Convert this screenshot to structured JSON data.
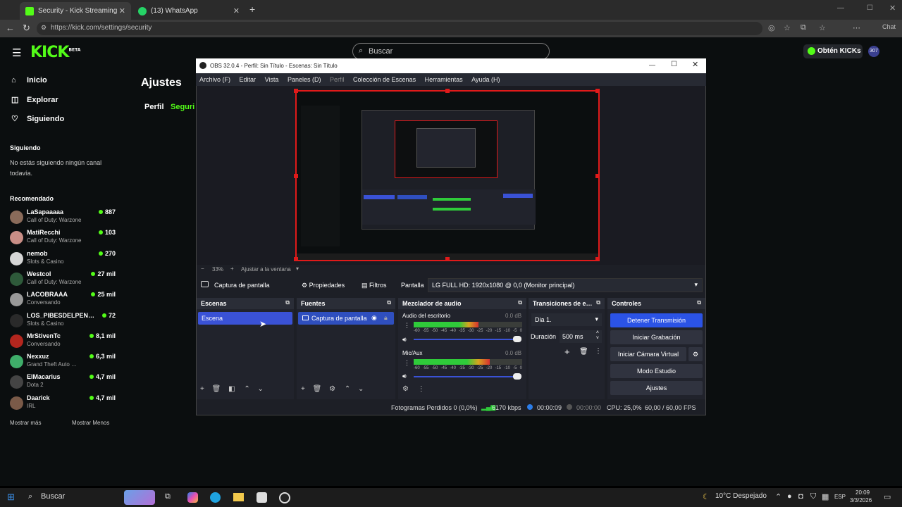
{
  "browser": {
    "tabs": [
      {
        "label": "Security - Kick Streaming",
        "color": "#53fc18"
      },
      {
        "label": "(13) WhatsApp",
        "color": "#25d366"
      }
    ],
    "url": "https://kick.com/settings/security",
    "chat_label": "Chat"
  },
  "kick": {
    "search_placeholder": "Buscar",
    "get_kicks": "Obtén KICKs",
    "avatar_text": "307",
    "nav": [
      {
        "label": "Inicio",
        "icon": "home-icon"
      },
      {
        "label": "Explorar",
        "icon": "compass-icon"
      },
      {
        "label": "Siguiendo",
        "icon": "heart-icon"
      }
    ],
    "following_title": "Siguiendo",
    "following_empty": "No estás siguiendo ningún canal todavía.",
    "recommended_title": "Recomendado",
    "recommended": [
      {
        "name": "LaSapaaaaa",
        "game": "Call of Duty: Warzone",
        "viewers": "887",
        "color": "#8a6b5a"
      },
      {
        "name": "MatiRecchi",
        "game": "Call of Duty: Warzone",
        "viewers": "103",
        "color": "#c98e86"
      },
      {
        "name": "nemob",
        "game": "Slots & Casino",
        "viewers": "270",
        "color": "#d6d6d6"
      },
      {
        "name": "Westcol",
        "game": "Call of Duty: Warzone",
        "viewers": "27 mil",
        "color": "#2e5a3a"
      },
      {
        "name": "LACOBRAAA",
        "game": "Conversando",
        "viewers": "25 mil",
        "color": "#999999"
      },
      {
        "name": "LOS_PIBESDELPEN…",
        "game": "Slots & Casino",
        "viewers": "72",
        "color": "#2a2a2a"
      },
      {
        "name": "MrStivenTc",
        "game": "Conversando",
        "viewers": "8,1 mil",
        "color": "#b3261e"
      },
      {
        "name": "Nexxuz",
        "game": "Grand Theft Auto …",
        "viewers": "6,3 mil",
        "color": "#3fae6a"
      },
      {
        "name": "ElMacarius",
        "game": "Dota 2",
        "viewers": "4,7 mil",
        "color": "#444444"
      },
      {
        "name": "Daarick",
        "game": "IRL",
        "viewers": "4,7 mil",
        "color": "#7a5a48"
      }
    ],
    "show_more": "Mostrar más",
    "show_less": "Mostrar Menos",
    "page_title": "Ajustes",
    "settings_tabs": [
      "Perfil",
      "Seguri"
    ]
  },
  "obs": {
    "title": "OBS 32.0.4 - Perfil: Sin Título - Escenas: Sin Título",
    "menu": [
      "Archivo (F)",
      "Editar",
      "Vista",
      "Paneles (D)",
      "Perfil",
      "Colección de Escenas",
      "Herramientas",
      "Ayuda (H)"
    ],
    "zoom": "33%",
    "fit_label": "Ajustar a la ventana",
    "source_name": "Captura de pantalla",
    "properties": "Propiedades",
    "filters": "Filtros",
    "screen_label": "Pantalla",
    "monitor": "LG FULL HD: 1920x1080 @ 0,0 (Monitor principal)",
    "docks": {
      "scenes": "Escenas",
      "sources": "Fuentes",
      "mixer": "Mezclador de audio",
      "transitions": "Transiciones de e…",
      "controls": "Controles"
    },
    "scene_item": "Escena",
    "source_item": "Captura de pantalla",
    "audio": [
      {
        "name": "Audio del escritorio",
        "db": "0.0 dB",
        "level": 0.6
      },
      {
        "name": "Mic/Aux",
        "db": "0.0 dB",
        "level": 0.7
      }
    ],
    "meter_scale": [
      "-60",
      "-55",
      "-50",
      "-45",
      "-40",
      "-35",
      "-30",
      "-25",
      "-20",
      "-15",
      "-10",
      "-5",
      "0"
    ],
    "transition": "Dia 1.",
    "duration_label": "Duración",
    "duration_value": "500 ms",
    "controls": [
      "Detener Transmisión",
      "Iniciar Grabación",
      "Iniciar Cámara Virtual",
      "Modo Estudio",
      "Ajustes"
    ],
    "status": {
      "dropped": "Fotogramas Perdidos 0 (0,0%)",
      "bitrate": "6170 kbps",
      "live_time": "00:00:09",
      "rec_time": "00:00:00",
      "cpu": "CPU: 25,0%",
      "fps": "60,00 / 60,00 FPS"
    }
  },
  "taskbar": {
    "search": "Buscar",
    "weather": "10°C Despejado",
    "lang": "ESP",
    "time": "20:09",
    "date": "3/3/2026"
  }
}
